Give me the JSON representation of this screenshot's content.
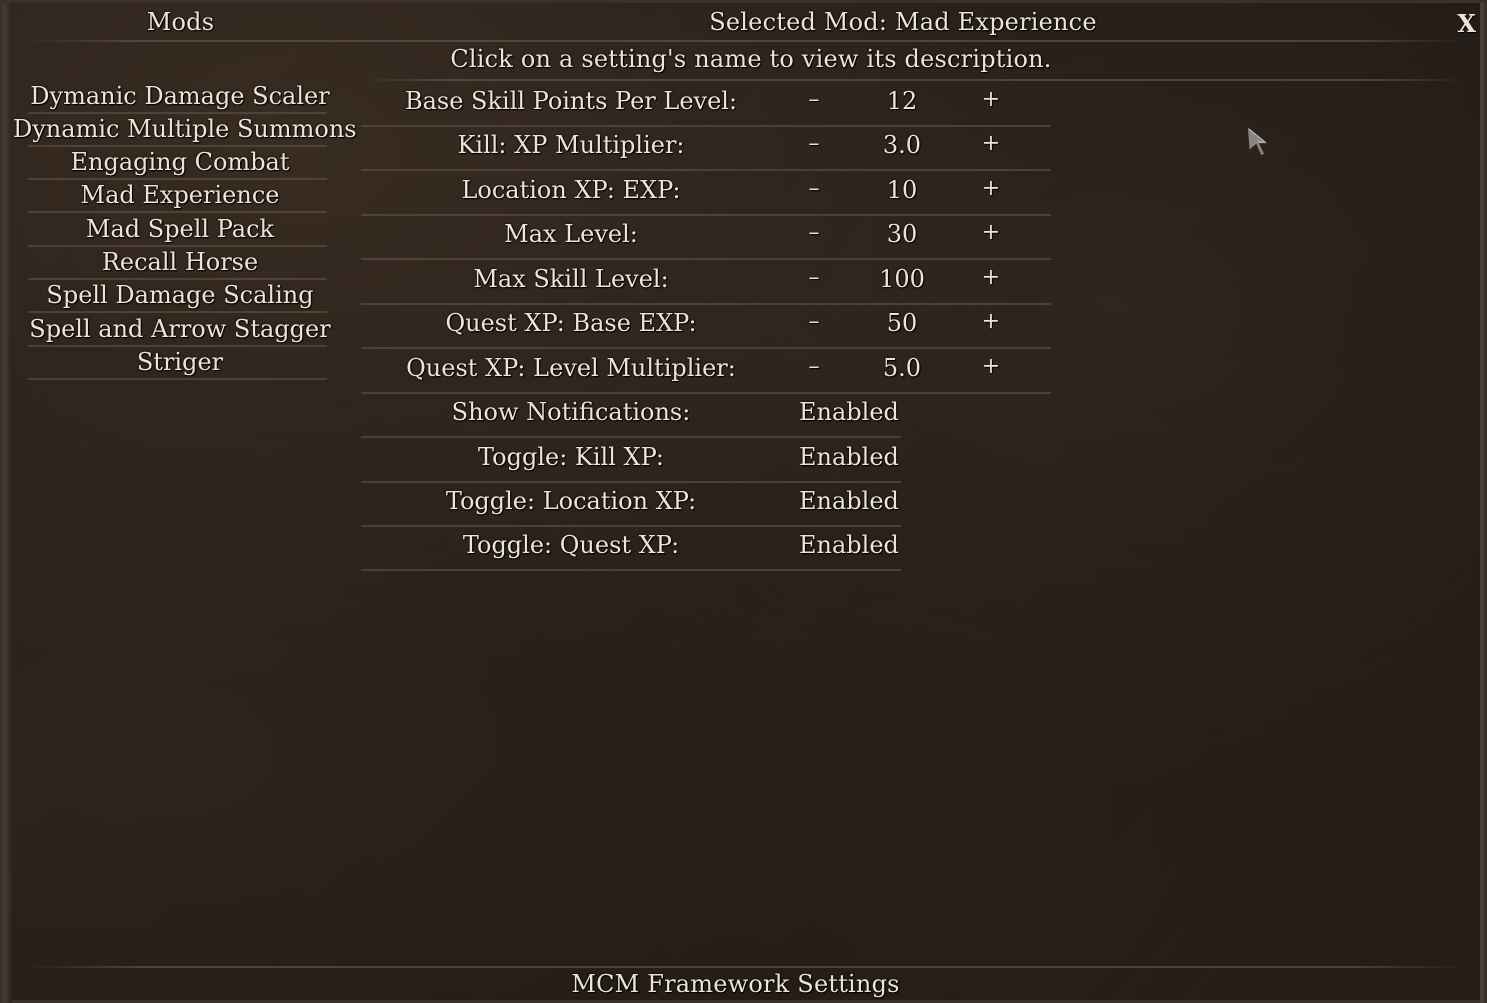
{
  "header": {
    "mods_title": "Mods",
    "selected_mod_title": "Selected Mod: Mad Experience",
    "close_label": "X",
    "instruction": "Click on a setting's name to view its description."
  },
  "mods": [
    {
      "label": "Dymanic Damage Scaler"
    },
    {
      "label": "Dynamic Multiple Summons"
    },
    {
      "label": "Engaging Combat"
    },
    {
      "label": "Mad Experience"
    },
    {
      "label": "Mad Spell Pack"
    },
    {
      "label": "Recall Horse"
    },
    {
      "label": "Spell Damage Scaling"
    },
    {
      "label": "Spell and Arrow Stagger"
    },
    {
      "label": "Striger"
    }
  ],
  "settings": [
    {
      "name": "Base Skill Points Per Level:",
      "minus": "–",
      "value": "12",
      "plus": "+"
    },
    {
      "name": "Kill: XP Multiplier:",
      "minus": "–",
      "value": "3.0",
      "plus": "+"
    },
    {
      "name": "Location XP: EXP:",
      "minus": "–",
      "value": "10",
      "plus": "+"
    },
    {
      "name": "Max Level:",
      "minus": "–",
      "value": "30",
      "plus": "+"
    },
    {
      "name": "Max Skill Level:",
      "minus": "–",
      "value": "100",
      "plus": "+"
    },
    {
      "name": "Quest XP: Base EXP:",
      "minus": "–",
      "value": "50",
      "plus": "+"
    },
    {
      "name": "Quest XP: Level Multiplier:",
      "minus": "–",
      "value": "5.0",
      "plus": "+"
    }
  ],
  "toggles": [
    {
      "name": "Show Notifications:",
      "value": "Enabled"
    },
    {
      "name": "Toggle: Kill XP:",
      "value": "Enabled"
    },
    {
      "name": "Toggle: Location XP:",
      "value": "Enabled"
    },
    {
      "name": "Toggle: Quest XP:",
      "value": "Enabled"
    }
  ],
  "footer": {
    "title": "MCM Framework Settings"
  },
  "icons": {
    "cursor": "mouse-pointer-icon",
    "close": "close-icon"
  },
  "colors": {
    "text": "#ece4d6",
    "background": "#241c16",
    "separator": "#6e6052"
  }
}
